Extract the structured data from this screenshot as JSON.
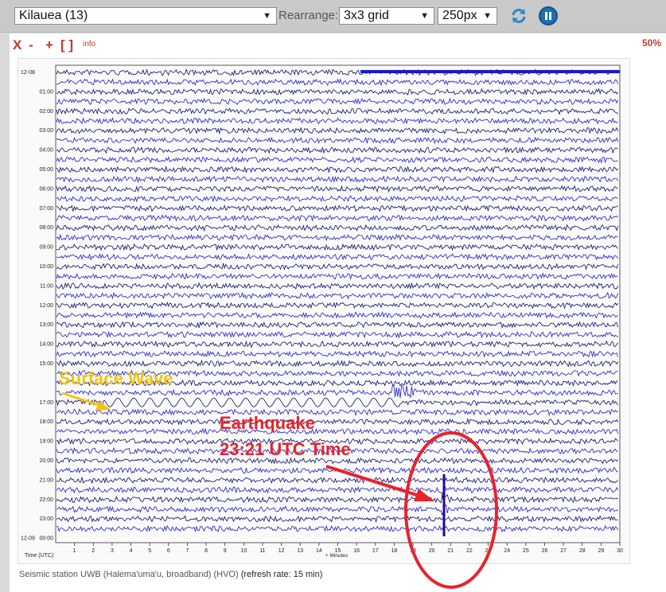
{
  "toolbar": {
    "station_select": "Kilauea (13)",
    "rearrange_label": "Rearrange:",
    "grid_select": "3x3 grid",
    "size_select": "250px"
  },
  "panel": {
    "close": "X",
    "minus": "-",
    "plus": "+",
    "brackets": "[ ]",
    "info": "info",
    "zoom": "50%"
  },
  "plot": {
    "date_start": "12-08",
    "date_end": "12-09",
    "hour_labels": [
      "01:00",
      "02:00",
      "03:00",
      "04:00",
      "05:00",
      "06:00",
      "07:00",
      "08:00",
      "09:00",
      "10:00",
      "11:00",
      "12:00",
      "13:00",
      "14:00",
      "15:00",
      "",
      "17:00",
      "18:00",
      "19:00",
      "20:00",
      "21:00",
      "22:00",
      "23:00",
      "00:00"
    ],
    "minute_ticks": [
      "1",
      "2",
      "3",
      "4",
      "5",
      "6",
      "7",
      "8",
      "9",
      "10",
      "11",
      "12",
      "13",
      "14",
      "15",
      "16",
      "17",
      "18",
      "19",
      "20",
      "21",
      "22",
      "23",
      "24",
      "25",
      "26",
      "27",
      "28",
      "29",
      "30"
    ],
    "xlabel": "+ Minutes",
    "time_label": "Time (UTC)",
    "trace_colors": [
      "#0a0a6e",
      "#1a1acc"
    ]
  },
  "annotations": {
    "surface_wave": "Surface Wave",
    "earthquake_line1": "Earthquake",
    "earthquake_line2": "23:21 UTC Time"
  },
  "caption": {
    "station": "Seismic station UWB (Halema'uma'u, broadband) (HVO)",
    "refresh": "(refresh rate: 15 min)"
  }
}
